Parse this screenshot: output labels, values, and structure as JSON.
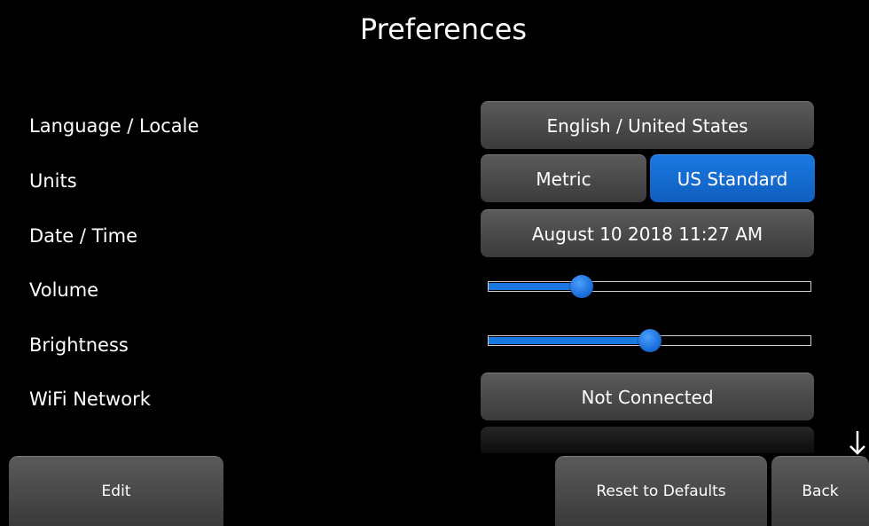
{
  "title": "Preferences",
  "settings": {
    "language": {
      "label": "Language / Locale",
      "value": "English / United States"
    },
    "units": {
      "label": "Units",
      "options": [
        "Metric",
        "US Standard"
      ],
      "selected": "US Standard"
    },
    "datetime": {
      "label": "Date / Time",
      "value": "August 10 2018 11:27 AM"
    },
    "volume": {
      "label": "Volume",
      "level": 0.29
    },
    "brightness": {
      "label": "Brightness",
      "level": 0.5
    },
    "wifi": {
      "label": "WiFi Network",
      "value": "Not Connected"
    }
  },
  "footer": {
    "edit_label": "Edit",
    "reset_label": "Reset to Defaults",
    "back_label": "Back"
  },
  "colors": {
    "accent": "#1b78e0",
    "background": "#000000",
    "button": "#4a4a4a"
  },
  "icons": {
    "scroll": "arrow-down-icon"
  }
}
